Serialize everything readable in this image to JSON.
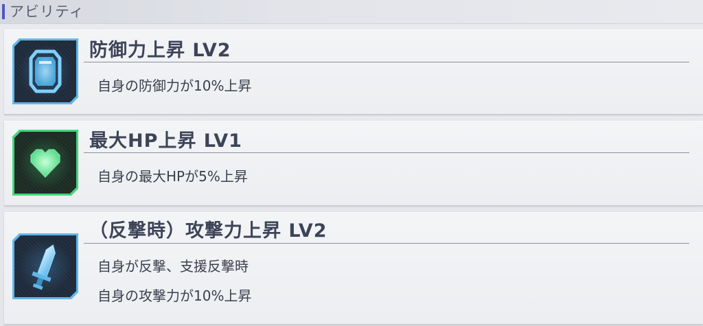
{
  "header": {
    "title": "アビリティ"
  },
  "abilities": [
    {
      "icon": "shield-icon",
      "frame_color": "#5fb7ea",
      "title": "防御力上昇 LV2",
      "description": [
        "自身の防御力が10%上昇"
      ]
    },
    {
      "icon": "heart-icon",
      "frame_color": "#46d47a",
      "title": "最大HP上昇 LV1",
      "description": [
        "自身の最大HPが5%上昇"
      ]
    },
    {
      "icon": "sword-icon",
      "frame_color": "#5fb7ea",
      "title": "（反撃時）攻撃力上昇 LV2",
      "description": [
        "自身が反撃、支援反撃時",
        "自身の攻撃力が10%上昇"
      ]
    }
  ]
}
